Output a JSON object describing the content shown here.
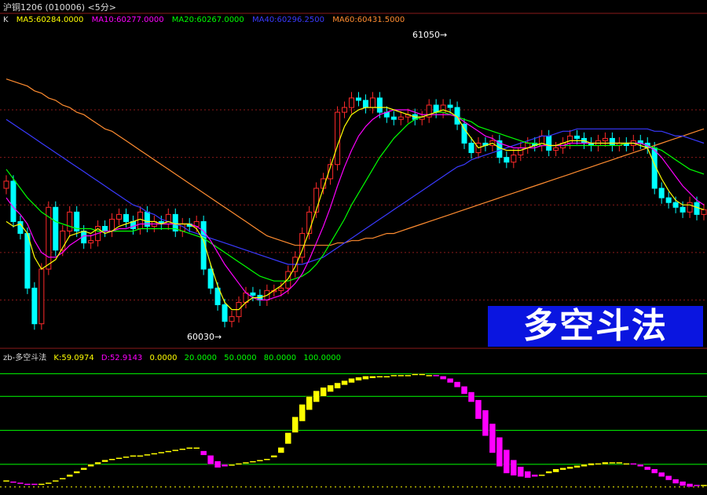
{
  "header": {
    "title": "沪铜1206 (010006) <5分>"
  },
  "main_legend": [
    {
      "text": "K",
      "color": "#dddddd"
    },
    {
      "text": "MA5:60284.0000",
      "color": "#ffff00"
    },
    {
      "text": "MA10:60277.0000",
      "color": "#ff00ff"
    },
    {
      "text": "MA20:60267.0000",
      "color": "#00ff00"
    },
    {
      "text": "MA40:60296.2500",
      "color": "#3a3aff"
    },
    {
      "text": "MA60:60431.5000",
      "color": "#ff8c30"
    }
  ],
  "sub_legend": [
    {
      "text": "zb-多空斗法",
      "color": "#dddddd"
    },
    {
      "text": "K:59.0974",
      "color": "#ffff00"
    },
    {
      "text": "D:52.9143",
      "color": "#ff00ff"
    },
    {
      "text": "0.0000",
      "color": "#ffff00"
    },
    {
      "text": "20.0000",
      "color": "#00ff00"
    },
    {
      "text": "50.0000",
      "color": "#00ff00"
    },
    {
      "text": "80.0000",
      "color": "#00ff00"
    },
    {
      "text": "100.0000",
      "color": "#00ff00"
    }
  ],
  "banner": {
    "text": "多空斗法"
  },
  "annotations": {
    "high": "61050→",
    "low": "60030→"
  },
  "colors": {
    "up": "#ff2a2a",
    "down": "#00ffff",
    "ma5": "#ffff00",
    "ma10": "#ff00ff",
    "ma20": "#00ff00",
    "ma40": "#3a3aff",
    "ma60": "#ff8c30",
    "k_line": "#ffff00",
    "d_fill": "#ff00ff",
    "grid": "#8b1a1a",
    "ref": "#00ff00"
  },
  "chart_data": [
    {
      "type": "candlestick",
      "title": "沪铜1206 (010006) <5分>",
      "ylim": [
        59960,
        61300
      ],
      "high_label": 61050,
      "low_label": 60030,
      "close": [
        60650,
        60480,
        60430,
        60200,
        60050,
        60280,
        60540,
        60360,
        60440,
        60520,
        60440,
        60390,
        60400,
        60460,
        60440,
        60490,
        60510,
        60480,
        60450,
        60520,
        60460,
        60480,
        60470,
        60510,
        60440,
        60470,
        60460,
        60480,
        60280,
        60200,
        60130,
        60060,
        60080,
        60140,
        60180,
        60170,
        60150,
        60190,
        60190,
        60200,
        60270,
        60330,
        60430,
        60520,
        60620,
        60660,
        60720,
        60940,
        60960,
        61000,
        60990,
        60960,
        61000,
        60940,
        60920,
        60910,
        60920,
        60930,
        60910,
        60920,
        60970,
        60940,
        60970,
        60960,
        60890,
        60810,
        60770,
        60810,
        60800,
        60820,
        60750,
        60730,
        60760,
        60790,
        60810,
        60800,
        60840,
        60780,
        60790,
        60810,
        60840,
        60830,
        60810,
        60800,
        60820,
        60830,
        60800,
        60810,
        60800,
        60820,
        60810,
        60790,
        60620,
        60580,
        60560,
        60540,
        60520,
        60560,
        60510,
        60530
      ],
      "ma5": [
        60480,
        60460,
        60470,
        60430,
        60330,
        60280,
        60300,
        60320,
        60370,
        60420,
        60430,
        60440,
        60430,
        60450,
        60430,
        60440,
        60460,
        60470,
        60480,
        60490,
        60480,
        60480,
        60470,
        60480,
        60470,
        60470,
        60470,
        60450,
        60400,
        60300,
        60210,
        60140,
        60110,
        60110,
        60140,
        60160,
        60160,
        60170,
        60190,
        60210,
        60240,
        60290,
        60360,
        60440,
        60530,
        60620,
        60710,
        60800,
        60880,
        60930,
        60950,
        60960,
        60960,
        60960,
        60960,
        60950,
        60940,
        60930,
        60920,
        60920,
        60930,
        60940,
        60950,
        60940,
        60920,
        60870,
        60830,
        60790,
        60800,
        60810,
        60790,
        60780,
        60780,
        60780,
        60790,
        60800,
        60810,
        60800,
        60800,
        60810,
        60820,
        60820,
        60820,
        60810,
        60810,
        60810,
        60810,
        60810,
        60810,
        60810,
        60800,
        60790,
        60720,
        60660,
        60610,
        60570,
        60550,
        60550,
        60540,
        60530
      ],
      "ma10": [
        60580,
        60540,
        60510,
        60470,
        60400,
        60350,
        60330,
        60330,
        60350,
        60380,
        60400,
        60420,
        60420,
        60430,
        60440,
        60440,
        60450,
        60450,
        60460,
        60470,
        60470,
        60470,
        60470,
        60470,
        60470,
        60470,
        60470,
        60460,
        60440,
        60400,
        60350,
        60300,
        60260,
        60220,
        60180,
        60160,
        60150,
        60150,
        60160,
        60170,
        60190,
        60220,
        60260,
        60320,
        60390,
        60460,
        60540,
        60630,
        60710,
        60780,
        60840,
        60880,
        60910,
        60930,
        60940,
        60950,
        60950,
        60950,
        60940,
        60930,
        60930,
        60930,
        60930,
        60930,
        60920,
        60900,
        60880,
        60860,
        60840,
        60830,
        60810,
        60800,
        60790,
        60790,
        60790,
        60790,
        60800,
        60800,
        60800,
        60800,
        60810,
        60810,
        60810,
        60810,
        60810,
        60810,
        60810,
        60810,
        60810,
        60810,
        60810,
        60800,
        60780,
        60750,
        60710,
        60670,
        60630,
        60600,
        60570,
        60550
      ],
      "ma20": [
        60700,
        60660,
        60620,
        60580,
        60550,
        60520,
        60500,
        60480,
        60470,
        60460,
        60450,
        60450,
        60450,
        60440,
        60440,
        60440,
        60440,
        60440,
        60440,
        60450,
        60450,
        60450,
        60450,
        60450,
        60450,
        60440,
        60430,
        60420,
        60410,
        60390,
        60370,
        60350,
        60330,
        60310,
        60290,
        60270,
        60250,
        60240,
        60230,
        60230,
        60230,
        60240,
        60250,
        60270,
        60300,
        60340,
        60390,
        60440,
        60490,
        60550,
        60600,
        60650,
        60700,
        60750,
        60790,
        60830,
        60860,
        60890,
        60910,
        60920,
        60930,
        60940,
        60940,
        60930,
        60920,
        60910,
        60900,
        60880,
        60870,
        60860,
        60850,
        60840,
        60830,
        60820,
        60810,
        60810,
        60800,
        60800,
        60800,
        60800,
        60800,
        60800,
        60800,
        60800,
        60800,
        60800,
        60800,
        60800,
        60810,
        60810,
        60810,
        60800,
        60790,
        60780,
        60760,
        60740,
        60720,
        60700,
        60690,
        60680
      ],
      "ma40": [
        60910,
        60890,
        60870,
        60850,
        60830,
        60810,
        60790,
        60770,
        60750,
        60730,
        60710,
        60690,
        60670,
        60650,
        60630,
        60610,
        60590,
        60570,
        60550,
        60540,
        60520,
        60510,
        60490,
        60480,
        60470,
        60460,
        60440,
        60430,
        60420,
        60410,
        60400,
        60390,
        60380,
        60370,
        60360,
        60350,
        60340,
        60330,
        60320,
        60310,
        60300,
        60300,
        60300,
        60310,
        60320,
        60330,
        60350,
        60370,
        60390,
        60410,
        60430,
        60450,
        60470,
        60490,
        60510,
        60530,
        60550,
        60570,
        60590,
        60610,
        60630,
        60650,
        60670,
        60690,
        60710,
        60720,
        60740,
        60750,
        60760,
        60770,
        60780,
        60790,
        60800,
        60810,
        60820,
        60830,
        60840,
        60840,
        60850,
        60860,
        60860,
        60870,
        60870,
        60870,
        60870,
        60870,
        60870,
        60870,
        60870,
        60870,
        60870,
        60870,
        60860,
        60860,
        60850,
        60840,
        60840,
        60830,
        60820,
        60810
      ],
      "ma60": [
        61080,
        61070,
        61060,
        61050,
        61030,
        61020,
        61000,
        60990,
        60970,
        60960,
        60940,
        60930,
        60910,
        60890,
        60870,
        60860,
        60840,
        60820,
        60800,
        60780,
        60760,
        60740,
        60720,
        60700,
        60680,
        60660,
        60640,
        60620,
        60600,
        60580,
        60560,
        60540,
        60520,
        60500,
        60480,
        60460,
        60440,
        60420,
        60410,
        60400,
        60390,
        60380,
        60380,
        60380,
        60380,
        60380,
        60380,
        60390,
        60390,
        60400,
        60400,
        60410,
        60410,
        60420,
        60430,
        60430,
        60440,
        60450,
        60460,
        60470,
        60480,
        60490,
        60500,
        60510,
        60520,
        60530,
        60540,
        60550,
        60560,
        60570,
        60580,
        60590,
        60600,
        60610,
        60620,
        60630,
        60640,
        60650,
        60660,
        60670,
        60680,
        60690,
        60700,
        60710,
        60720,
        60730,
        60740,
        60750,
        60760,
        60770,
        60780,
        60790,
        60800,
        60810,
        60820,
        60830,
        60840,
        60850,
        60860,
        60870
      ]
    },
    {
      "type": "bar",
      "title": "zb-多空斗法",
      "ylim": [
        -5,
        110
      ],
      "reference_lines": [
        0,
        20,
        50,
        80,
        100
      ],
      "k": [
        6,
        4,
        3,
        2,
        2,
        3,
        4,
        6,
        8,
        11,
        14,
        17,
        20,
        22,
        24,
        25,
        26,
        27,
        28,
        28,
        29,
        30,
        31,
        32,
        33,
        34,
        35,
        35,
        28,
        20,
        17,
        18,
        20,
        21,
        22,
        23,
        24,
        25,
        28,
        35,
        48,
        62,
        73,
        80,
        85,
        88,
        90,
        92,
        94,
        96,
        97,
        98,
        98,
        98,
        98,
        99,
        99,
        99,
        100,
        100,
        99,
        98,
        95,
        92,
        88,
        82,
        75,
        60,
        45,
        30,
        18,
        12,
        10,
        9,
        8,
        9,
        11,
        14,
        16,
        17,
        18,
        19,
        20,
        21,
        21,
        22,
        22,
        22,
        21,
        20,
        18,
        15,
        12,
        9,
        6,
        3,
        1,
        0,
        1,
        2
      ],
      "d": [
        5,
        5,
        4,
        3,
        3,
        3,
        4,
        5,
        7,
        9,
        12,
        15,
        18,
        20,
        22,
        24,
        25,
        26,
        27,
        28,
        28,
        29,
        30,
        31,
        32,
        33,
        34,
        34,
        32,
        28,
        23,
        20,
        19,
        20,
        21,
        22,
        23,
        24,
        26,
        30,
        38,
        48,
        58,
        68,
        75,
        80,
        84,
        87,
        90,
        92,
        94,
        95,
        96,
        97,
        97,
        98,
        98,
        98,
        99,
        99,
        99,
        99,
        98,
        96,
        93,
        89,
        84,
        77,
        68,
        56,
        44,
        33,
        24,
        18,
        14,
        11,
        11,
        12,
        13,
        15,
        16,
        17,
        18,
        19,
        20,
        20,
        21,
        21,
        21,
        21,
        20,
        18,
        16,
        13,
        10,
        7,
        5,
        3,
        2,
        2
      ]
    }
  ]
}
